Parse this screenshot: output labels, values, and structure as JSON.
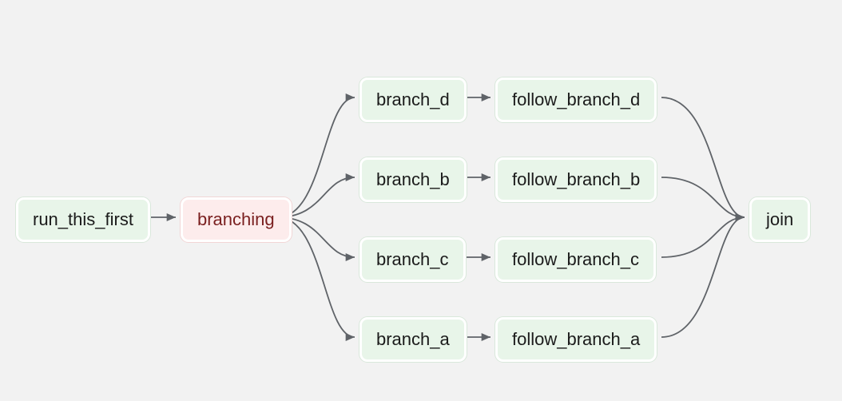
{
  "nodes": {
    "run_this_first": "run_this_first",
    "branching": "branching",
    "branch_d": "branch_d",
    "branch_b": "branch_b",
    "branch_c": "branch_c",
    "branch_a": "branch_a",
    "follow_branch_d": "follow_branch_d",
    "follow_branch_b": "follow_branch_b",
    "follow_branch_c": "follow_branch_c",
    "follow_branch_a": "follow_branch_a",
    "join": "join"
  }
}
